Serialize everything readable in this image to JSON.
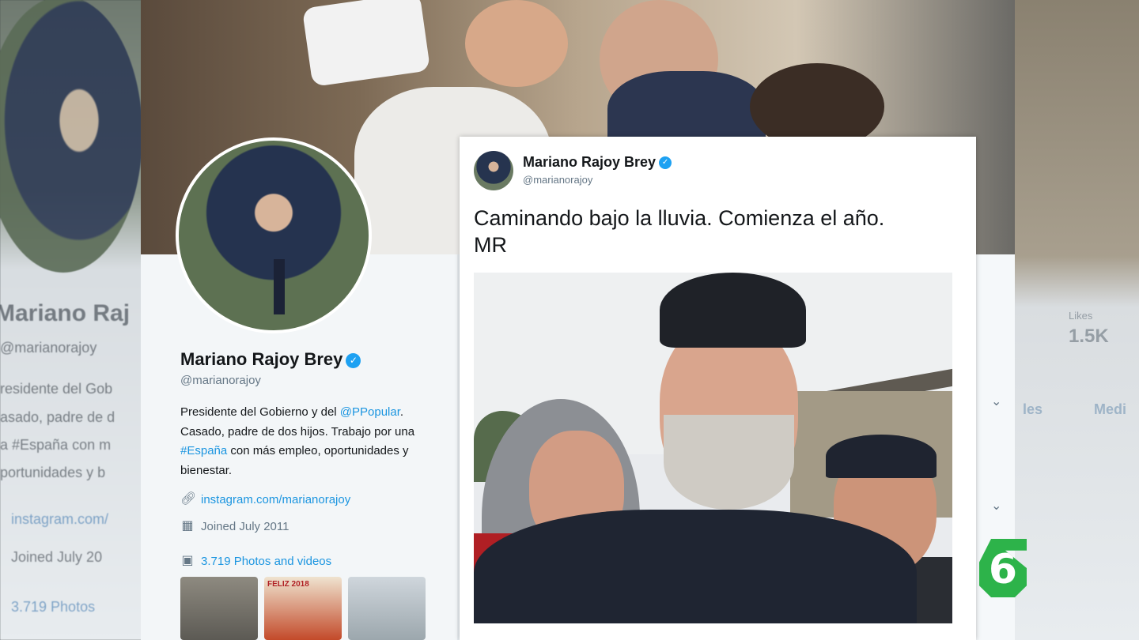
{
  "profile": {
    "name": "Mariano Rajoy Brey",
    "handle": "@marianorajoy",
    "bio_part1": "Presidente del Gobierno y del ",
    "bio_mention": "@PPopular",
    "bio_part2": ". Casado, padre de dos hijos. Trabajo por una ",
    "bio_hashtag": "#España",
    "bio_part3": " con más empleo, oportunidades y bienestar.",
    "website": "instagram.com/marianorajoy",
    "joined": "Joined July 2011",
    "photos_link": "3.719 Photos and videos",
    "thumb_caption": "FELIZ 2018"
  },
  "tweet": {
    "name": "Mariano Rajoy Brey",
    "handle": "@marianorajoy",
    "text_line1": "Caminando bajo la lluvia. Comienza el año.",
    "text_line2": "MR"
  },
  "background": {
    "left_name": "Mariano Raj",
    "left_handle": "@marianorajoy",
    "left_bio1": "residente del Gob",
    "left_bio2": "asado, padre de d",
    "left_bio3": "a #España con m",
    "left_bio4": "portunidades y b",
    "left_link": "instagram.com/",
    "left_joined": "Joined July 20",
    "left_photos": "3.719 Photos",
    "right_stat_label": "Likes",
    "right_stat_value": "1.5K",
    "right_link1": "les",
    "right_link2": "Medi"
  },
  "logo": {
    "text": "6"
  },
  "colors": {
    "link": "#1b95e0",
    "verified": "#1da1f2",
    "logo": "#2db34a"
  }
}
